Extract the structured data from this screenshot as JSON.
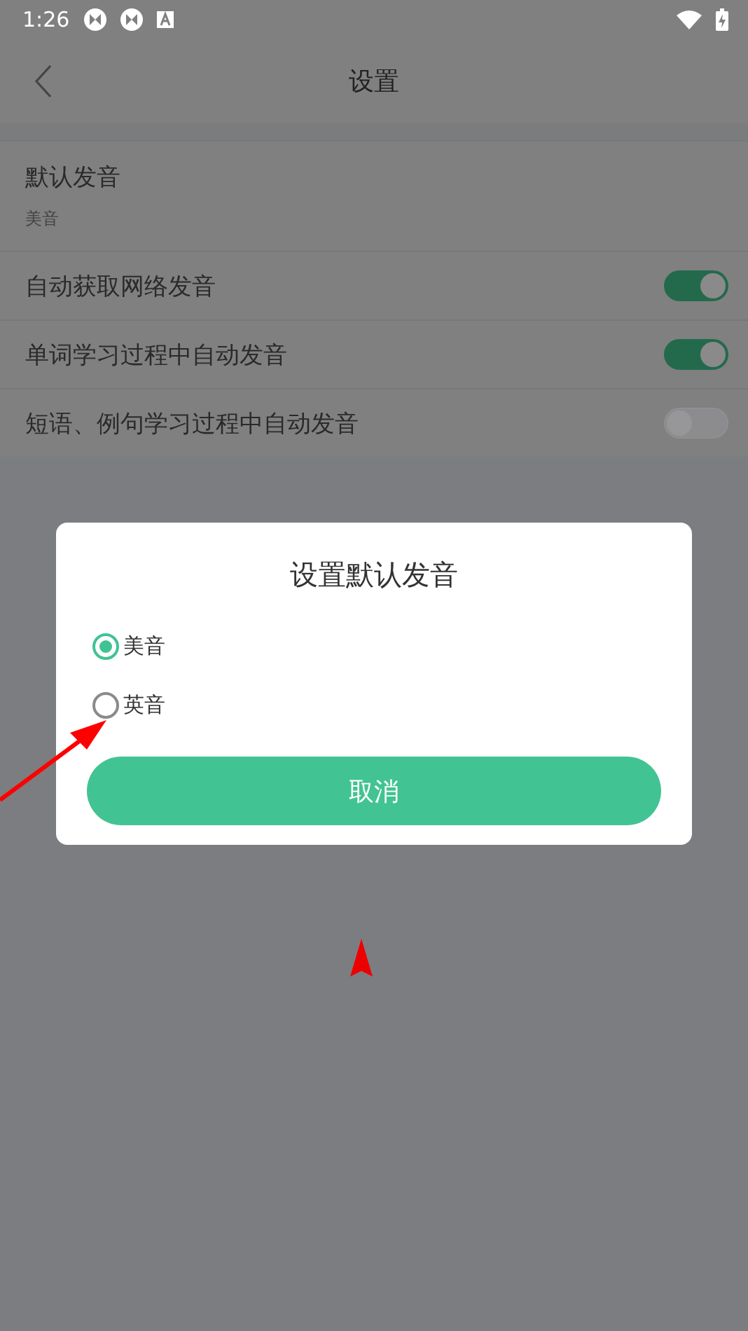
{
  "status_bar": {
    "time": "1:26"
  },
  "header": {
    "title": "设置"
  },
  "settings": [
    {
      "kind": "value",
      "label": "默认发音",
      "value": "美音"
    },
    {
      "kind": "toggle",
      "label": "自动获取网络发音",
      "on": true
    },
    {
      "kind": "toggle",
      "label": "单词学习过程中自动发音",
      "on": true
    },
    {
      "kind": "toggle",
      "label": "短语、例句学习过程中自动发音",
      "on": false
    }
  ],
  "dialog": {
    "title": "设置默认发音",
    "options": [
      {
        "label": "美音",
        "selected": true
      },
      {
        "label": "英音",
        "selected": false
      }
    ],
    "button": "取消"
  }
}
